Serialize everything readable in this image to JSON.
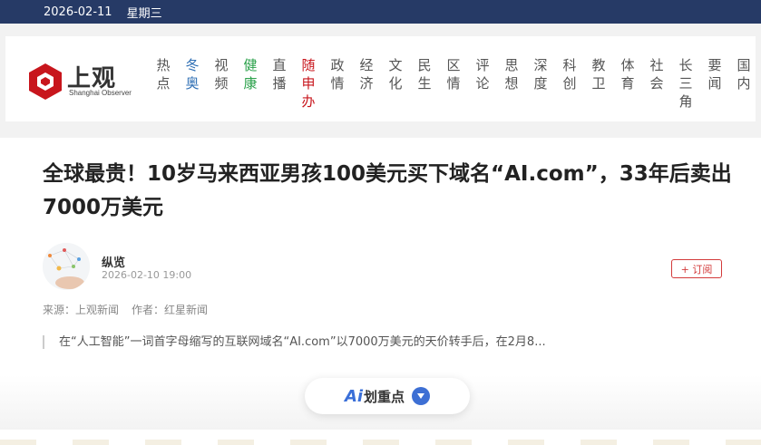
{
  "topbar": {
    "date": "2026-02-11",
    "weekday": "星期三"
  },
  "logo": {
    "name_cn": "上观",
    "name_en": "Shanghai Observer"
  },
  "nav": {
    "items": [
      {
        "label": [
          "热",
          "点"
        ],
        "color": ""
      },
      {
        "label": [
          "冬",
          "奥"
        ],
        "color": "blue"
      },
      {
        "label": [
          "视",
          "频"
        ],
        "color": ""
      },
      {
        "label": [
          "健",
          "康"
        ],
        "color": "green"
      },
      {
        "label": [
          "直",
          "播"
        ],
        "color": ""
      },
      {
        "label": [
          "随",
          "申",
          "办"
        ],
        "color": "red"
      },
      {
        "label": [
          "政",
          "情"
        ],
        "color": ""
      },
      {
        "label": [
          "经",
          "济"
        ],
        "color": ""
      },
      {
        "label": [
          "文",
          "化"
        ],
        "color": ""
      },
      {
        "label": [
          "民",
          "生"
        ],
        "color": ""
      },
      {
        "label": [
          "区",
          "情"
        ],
        "color": ""
      },
      {
        "label": [
          "评",
          "论"
        ],
        "color": ""
      },
      {
        "label": [
          "思",
          "想"
        ],
        "color": ""
      },
      {
        "label": [
          "深",
          "度"
        ],
        "color": ""
      },
      {
        "label": [
          "科",
          "创"
        ],
        "color": ""
      },
      {
        "label": [
          "教",
          "卫"
        ],
        "color": ""
      },
      {
        "label": [
          "体",
          "育"
        ],
        "color": ""
      },
      {
        "label": [
          "社",
          "会"
        ],
        "color": ""
      },
      {
        "label": [
          "长",
          "三",
          "角"
        ],
        "color": ""
      },
      {
        "label": [
          "要",
          "闻"
        ],
        "color": ""
      },
      {
        "label": [
          "国",
          "内"
        ],
        "color": ""
      }
    ]
  },
  "article": {
    "title": "全球最贵！10岁马来西亚男孩100美元买下域名“AI.com”，33年后卖出7000万美元",
    "author": "纵览",
    "publish_time": "2026-02-10 19:00",
    "subscribe_label": "+ 订阅",
    "source": "来源：上观新闻",
    "writer": "作者：红星新闻",
    "summary": "在“人工智能”一词首字母缩写的互联网域名“AI.com”以7000万美元的天价转手后，在2月8...",
    "ai_prefix": "Ai",
    "ai_label": "划重点"
  },
  "colors": {
    "topbar_bg": "#263a66",
    "brand_red": "#c8161d",
    "accent_blue": "#3d6fd4",
    "subscribe_red": "#d33a3a"
  },
  "icons": [
    "logo-hexagon-icon",
    "avatar-image",
    "chevron-down-icon"
  ]
}
